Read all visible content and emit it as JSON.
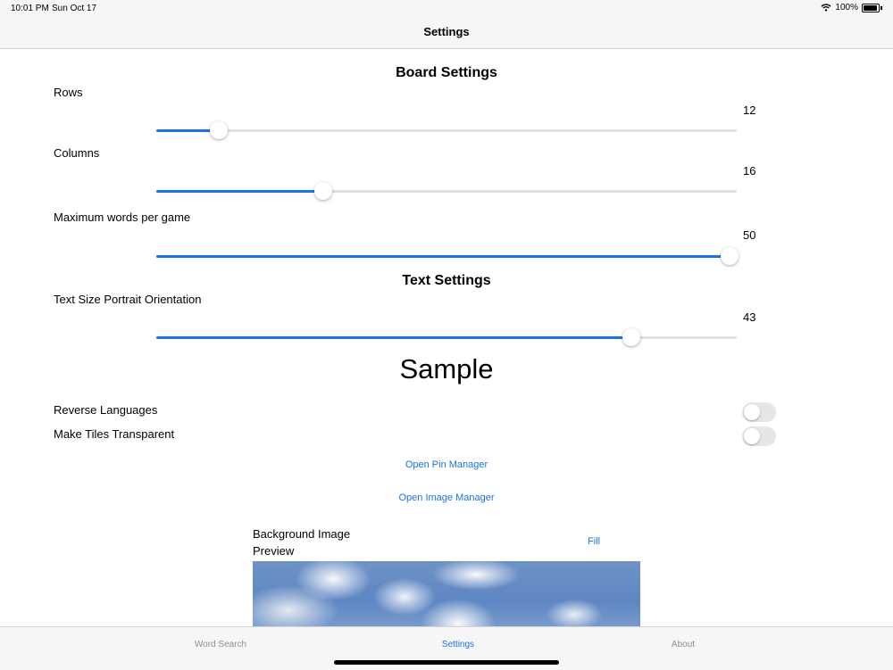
{
  "status": {
    "time": "10:01 PM",
    "date": "Sun Oct 17",
    "battery": "100%"
  },
  "nav": {
    "title": "Settings"
  },
  "board": {
    "title": "Board Settings",
    "rows": {
      "label": "Rows",
      "value": "12",
      "fraction": 0.108
    },
    "columns": {
      "label": "Columns",
      "value": "16",
      "fraction": 0.288
    },
    "max_words": {
      "label": "Maximum words per game",
      "value": "50",
      "fraction": 0.988
    }
  },
  "text": {
    "title": "Text Settings",
    "size_portrait": {
      "label": "Text Size Portrait Orientation",
      "value": "43",
      "fraction": 0.818
    },
    "sample": "Sample"
  },
  "toggles": {
    "reverse": {
      "label": "Reverse Languages",
      "on": false
    },
    "transparent": {
      "label": "Make Tiles Transparent",
      "on": false
    }
  },
  "links": {
    "pin_manager": "Open Pin Manager",
    "image_manager": "Open Image Manager"
  },
  "background": {
    "label": "Background Image",
    "preview_label": "Preview",
    "fill": "Fill"
  },
  "tabs": [
    {
      "label": "Word Search"
    },
    {
      "label": "Settings"
    },
    {
      "label": "About"
    }
  ],
  "colors": {
    "accent": "#1a73e8",
    "bar": "#f6f6f6",
    "inactive_tab": "#8e8e93"
  }
}
